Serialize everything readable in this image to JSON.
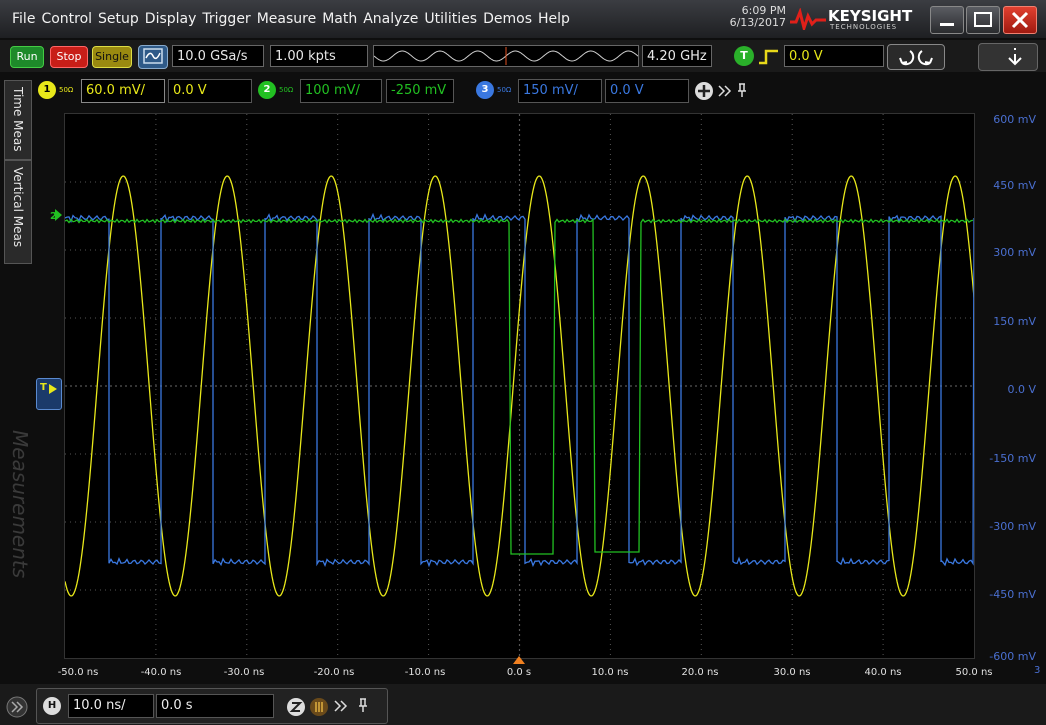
{
  "menu": [
    "File",
    "Control",
    "Setup",
    "Display",
    "Trigger",
    "Measure",
    "Math",
    "Analyze",
    "Utilities",
    "Demos",
    "Help"
  ],
  "clock": {
    "time": "6:09 PM",
    "date": "6/13/2017"
  },
  "brand": {
    "name": "KEYSIGHT",
    "sub": "TECHNOLOGIES"
  },
  "acq": {
    "run": "Run",
    "stop": "Stop",
    "single": "Single",
    "sample_rate": "10.0 GSa/s",
    "memory": "1.00 kpts",
    "bandwidth": "4.20 GHz"
  },
  "trigger": {
    "badge": "T",
    "level": "0.0 V"
  },
  "channels": [
    {
      "num": "1",
      "ohm": "50Ω",
      "scale": "60.0 mV/",
      "offset": "0.0 V",
      "color": "#e8e81a"
    },
    {
      "num": "2",
      "ohm": "50Ω",
      "scale": "100 mV/",
      "offset": "-250 mV",
      "color": "#22c022"
    },
    {
      "num": "3",
      "ohm": "50Ω",
      "scale": "150 mV/",
      "offset": "0.0 V",
      "color": "#3a78e0"
    }
  ],
  "sidetabs": {
    "time_meas": "Time Meas",
    "vertical_meas": "Vertical Meas",
    "measurements": "Measurements"
  },
  "markers": {
    "ch2": "2",
    "trig": "T"
  },
  "yaxis": [
    "600 mV",
    "450 mV",
    "300 mV",
    "150 mV",
    "0.0 V",
    "-150 mV",
    "-300 mV",
    "-450 mV",
    "-600 mV"
  ],
  "xaxis": [
    "-50.0 ns",
    "-40.0 ns",
    "-30.0 ns",
    "-20.0 ns",
    "-10.0 ns",
    "0.0 s",
    "10.0 ns",
    "20.0 ns",
    "30.0 ns",
    "40.0 ns",
    "50.0 ns"
  ],
  "right_edge_label": "3",
  "timebase": {
    "badge": "H",
    "scale": "10.0 ns/",
    "delay": "0.0 s"
  },
  "colors": {
    "ch1": "#e8e81a",
    "ch2": "#22c022",
    "ch3": "#3a78e0",
    "grid": "#555555"
  }
}
